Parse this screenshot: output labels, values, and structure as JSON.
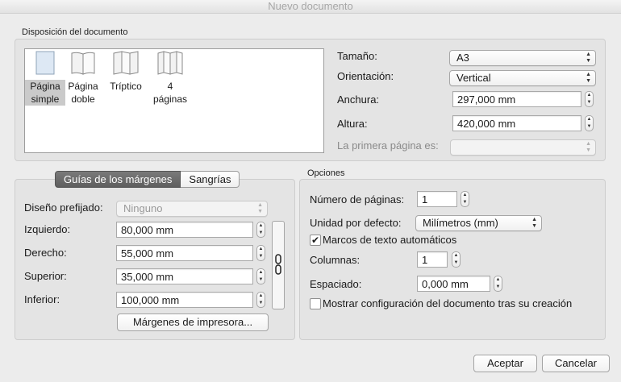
{
  "window": {
    "title": "Nuevo documento"
  },
  "layout_section": {
    "title": "Disposición del documento",
    "presets": [
      {
        "label_lines": [
          "Página",
          "simple"
        ],
        "icon": "single-page-icon",
        "selected": true
      },
      {
        "label_lines": [
          "Página",
          "doble"
        ],
        "icon": "double-page-icon",
        "selected": false
      },
      {
        "label_lines": [
          "Tríptico"
        ],
        "icon": "triptych-icon",
        "selected": false
      },
      {
        "label_lines": [
          "4",
          "páginas"
        ],
        "icon": "four-pages-icon",
        "selected": false
      }
    ],
    "size_label": "Tamaño:",
    "size_value": "A3",
    "orientation_label": "Orientación:",
    "orientation_value": "Vertical",
    "width_label": "Anchura:",
    "width_value": "297,000 mm",
    "height_label": "Altura:",
    "height_value": "420,000 mm",
    "first_page_label": "La primera página es:",
    "first_page_value": ""
  },
  "margins_section": {
    "tabs": [
      {
        "label": "Guías de los márgenes",
        "active": true
      },
      {
        "label": "Sangrías",
        "active": false
      }
    ],
    "preset_label": "Diseño prefijado:",
    "preset_value": "Ninguno",
    "left_label": "Izquierdo:",
    "left_value": "80,000 mm",
    "right_label": "Derecho:",
    "right_value": "55,000 mm",
    "top_label": "Superior:",
    "top_value": "35,000 mm",
    "bottom_label": "Inferior:",
    "bottom_value": "100,000 mm",
    "printer_margins_button": "Márgenes de impresora..."
  },
  "options_section": {
    "title": "Opciones",
    "num_pages_label": "Número de páginas:",
    "num_pages_value": "1",
    "default_unit_label": "Unidad por defecto:",
    "default_unit_value": "Milímetros (mm)",
    "auto_text_frames_label": "Marcos de texto automáticos",
    "auto_text_frames_checked": true,
    "columns_label": "Columnas:",
    "columns_value": "1",
    "spacing_label": "Espaciado:",
    "spacing_value": "0,000 mm",
    "show_settings_label": "Mostrar configuración del documento tras su creación",
    "show_settings_checked": false
  },
  "footer": {
    "accept_button": "Aceptar",
    "cancel_button": "Cancelar"
  }
}
